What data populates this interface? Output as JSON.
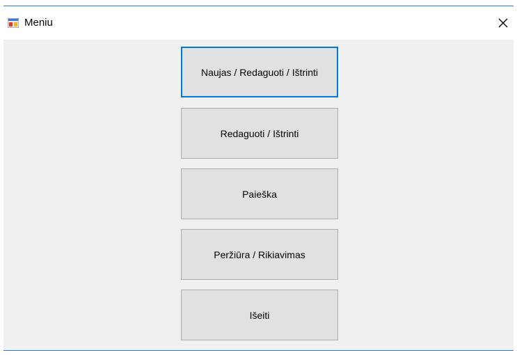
{
  "window": {
    "title": "Meniu",
    "app_icon": "windows-form-icon",
    "close_icon": "close-icon"
  },
  "menu": {
    "buttons": [
      {
        "label": "Naujas / Redaguoti / Ištrinti",
        "focused": true
      },
      {
        "label": "Redaguoti / Ištrinti",
        "focused": false
      },
      {
        "label": "Paieška",
        "focused": false
      },
      {
        "label": "Peržiūra / Rikiavimas",
        "focused": false
      },
      {
        "label": "Išeiti",
        "focused": false
      }
    ]
  },
  "colors": {
    "window_border": "#2b79d7",
    "client_background": "#f0f0f0",
    "button_face": "#e1e1e1",
    "button_border": "#adadad",
    "focus_border": "#0078d7"
  }
}
